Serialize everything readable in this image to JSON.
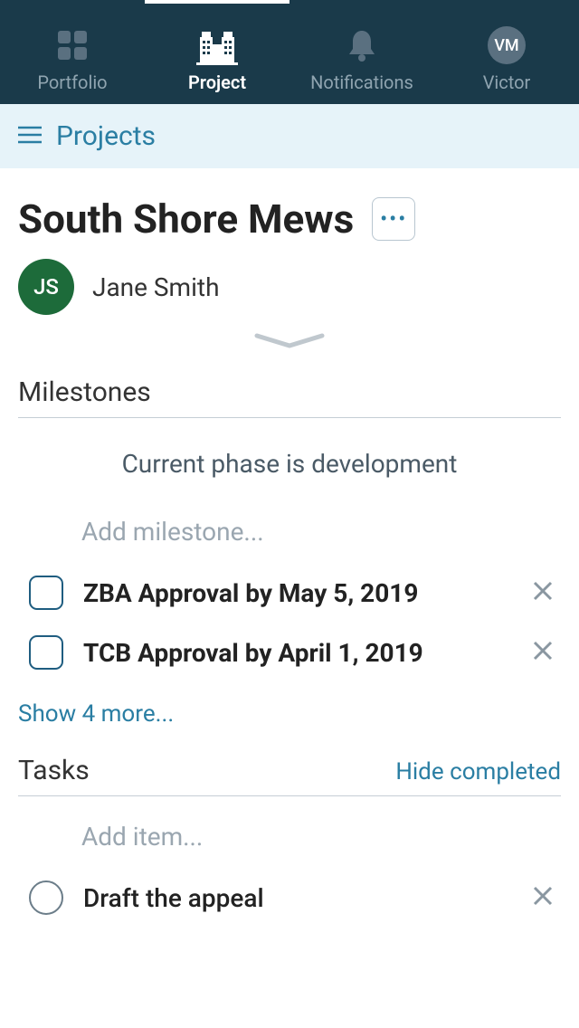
{
  "nav": {
    "items": [
      {
        "label": "Portfolio"
      },
      {
        "label": "Project"
      },
      {
        "label": "Notifications"
      },
      {
        "label": "Victor",
        "initials": "VM"
      }
    ]
  },
  "breadcrumb": {
    "label": "Projects"
  },
  "header": {
    "title": "South Shore Mews",
    "owner": {
      "initials": "JS",
      "name": "Jane Smith"
    }
  },
  "milestones": {
    "title": "Milestones",
    "phase_banner": "Current phase is development",
    "add_placeholder": "Add milestone...",
    "items": [
      {
        "label": "ZBA Approval by May 5, 2019"
      },
      {
        "label": "TCB Approval by April 1, 2019"
      }
    ],
    "show_more": "Show 4 more..."
  },
  "tasks": {
    "title": "Tasks",
    "hide_completed": "Hide completed",
    "add_placeholder": "Add item...",
    "items": [
      {
        "label": "Draft the appeal"
      }
    ]
  }
}
